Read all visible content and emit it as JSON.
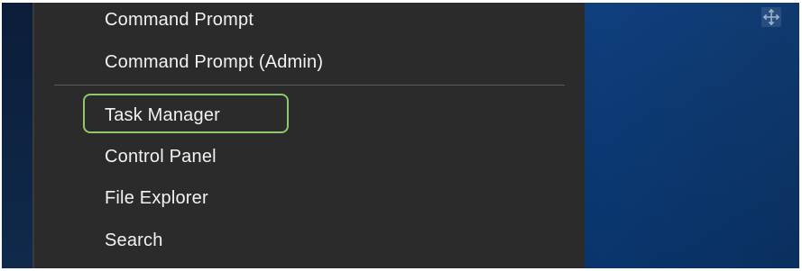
{
  "context_menu": {
    "items": [
      {
        "label": "Command Prompt"
      },
      {
        "label": "Command Prompt (Admin)"
      },
      {
        "label": "Task Manager"
      },
      {
        "label": "Control Panel"
      },
      {
        "label": "File Explorer"
      },
      {
        "label": "Search"
      }
    ]
  },
  "icons": {
    "move_handle": "move-icon"
  },
  "colors": {
    "menu_background": "#2b2b2b",
    "highlight": "#8ec86e",
    "desktop_blue": "#0a3a78"
  }
}
